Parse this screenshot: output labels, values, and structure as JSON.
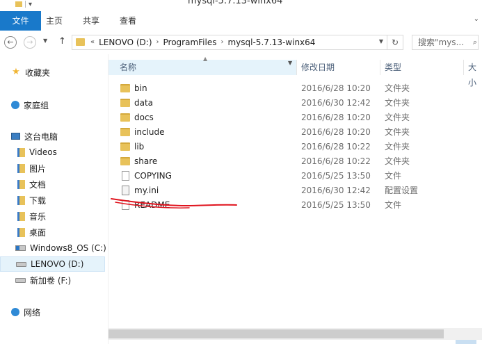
{
  "window": {
    "title": "mysql-5.7.13-winx64"
  },
  "ribbon": {
    "tabs": [
      "文件",
      "主页",
      "共享",
      "查看"
    ]
  },
  "address": {
    "crumbs": [
      "LENOVO (D:)",
      "ProgramFiles",
      "mysql-5.7.13-winx64"
    ]
  },
  "search": {
    "placeholder": "搜索\"mys..."
  },
  "nav": {
    "favorites": "收藏夹",
    "homegroup": "家庭组",
    "thispc": "这台电脑",
    "libs": [
      "Videos",
      "图片",
      "文档",
      "下载",
      "音乐",
      "桌面"
    ],
    "drives": [
      "Windows8_OS (C:)",
      "LENOVO (D:)",
      "新加卷 (F:)"
    ],
    "network": "网络"
  },
  "columns": {
    "name": "名称",
    "date": "修改日期",
    "type": "类型",
    "size": "大小"
  },
  "files": [
    {
      "name": "bin",
      "date": "2016/6/28 10:20",
      "type": "文件夹",
      "icon": "folder-icon"
    },
    {
      "name": "data",
      "date": "2016/6/30 12:42",
      "type": "文件夹",
      "icon": "folder-icon"
    },
    {
      "name": "docs",
      "date": "2016/6/28 10:20",
      "type": "文件夹",
      "icon": "folder-icon"
    },
    {
      "name": "include",
      "date": "2016/6/28 10:20",
      "type": "文件夹",
      "icon": "folder-icon"
    },
    {
      "name": "lib",
      "date": "2016/6/28 10:22",
      "type": "文件夹",
      "icon": "folder-icon"
    },
    {
      "name": "share",
      "date": "2016/6/28 10:22",
      "type": "文件夹",
      "icon": "folder-icon"
    },
    {
      "name": "COPYING",
      "date": "2016/5/25 13:50",
      "type": "文件",
      "icon": "file-icon"
    },
    {
      "name": "my.ini",
      "date": "2016/6/30 12:42",
      "type": "配置设置",
      "icon": "ini-file-icon"
    },
    {
      "name": "README",
      "date": "2016/5/25 13:50",
      "type": "文件",
      "icon": "file-icon"
    }
  ],
  "colors": {
    "accent": "#1979ca",
    "folder": "#e8c25a",
    "annotation": "#e0141e",
    "selection": "#e5f3fb"
  }
}
